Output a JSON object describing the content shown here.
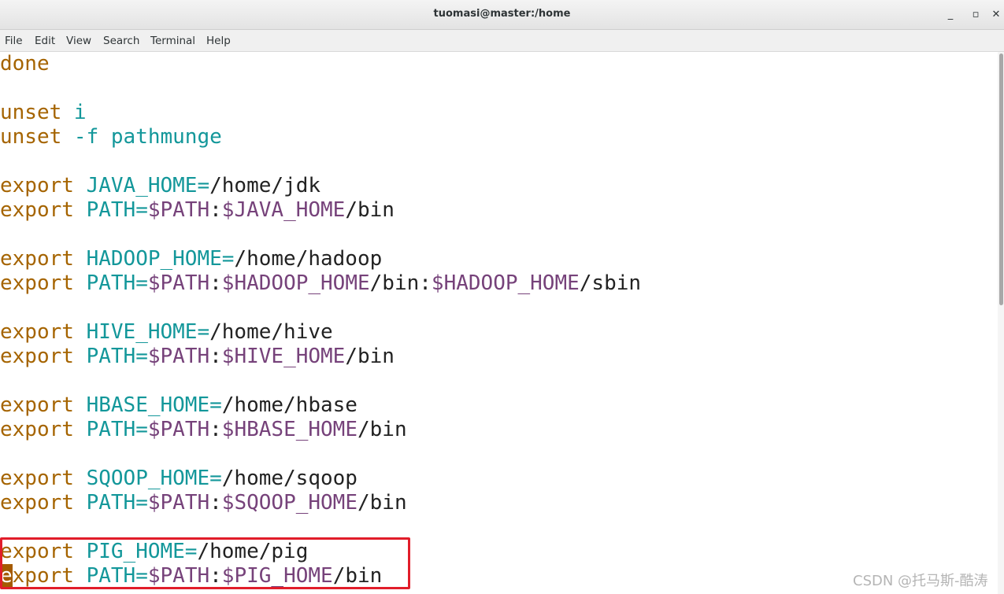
{
  "window": {
    "title": "tuomasi@master:/home",
    "min_glyph": "_",
    "max_glyph": "▫",
    "close_glyph": "✕"
  },
  "menu": {
    "items": [
      "File",
      "Edit",
      "View",
      "Search",
      "Terminal",
      "Help"
    ]
  },
  "terminal": {
    "lines": [
      [
        {
          "t": "done",
          "c": "kw"
        }
      ],
      [],
      [
        {
          "t": "unset ",
          "c": "kw"
        },
        {
          "t": "i",
          "c": "var"
        }
      ],
      [
        {
          "t": "unset ",
          "c": "kw"
        },
        {
          "t": "-f pathmunge",
          "c": "var"
        }
      ],
      [],
      [
        {
          "t": "export ",
          "c": "kw"
        },
        {
          "t": "JAVA_HOME=",
          "c": "var"
        },
        {
          "t": "/home/jdk",
          "c": "txt"
        }
      ],
      [
        {
          "t": "export ",
          "c": "kw"
        },
        {
          "t": "PATH=",
          "c": "var"
        },
        {
          "t": "$PATH",
          "c": "ref"
        },
        {
          "t": ":",
          "c": "txt"
        },
        {
          "t": "$JAVA_HOME",
          "c": "ref"
        },
        {
          "t": "/bin",
          "c": "txt"
        }
      ],
      [],
      [
        {
          "t": "export ",
          "c": "kw"
        },
        {
          "t": "HADOOP_HOME=",
          "c": "var"
        },
        {
          "t": "/home/hadoop",
          "c": "txt"
        }
      ],
      [
        {
          "t": "export ",
          "c": "kw"
        },
        {
          "t": "PATH=",
          "c": "var"
        },
        {
          "t": "$PATH",
          "c": "ref"
        },
        {
          "t": ":",
          "c": "txt"
        },
        {
          "t": "$HADOOP_HOME",
          "c": "ref"
        },
        {
          "t": "/bin:",
          "c": "txt"
        },
        {
          "t": "$HADOOP_HOME",
          "c": "ref"
        },
        {
          "t": "/sbin",
          "c": "txt"
        }
      ],
      [],
      [
        {
          "t": "export ",
          "c": "kw"
        },
        {
          "t": "HIVE_HOME=",
          "c": "var"
        },
        {
          "t": "/home/hive",
          "c": "txt"
        }
      ],
      [
        {
          "t": "export ",
          "c": "kw"
        },
        {
          "t": "PATH=",
          "c": "var"
        },
        {
          "t": "$PATH",
          "c": "ref"
        },
        {
          "t": ":",
          "c": "txt"
        },
        {
          "t": "$HIVE_HOME",
          "c": "ref"
        },
        {
          "t": "/bin",
          "c": "txt"
        }
      ],
      [],
      [
        {
          "t": "export ",
          "c": "kw"
        },
        {
          "t": "HBASE_HOME=",
          "c": "var"
        },
        {
          "t": "/home/hbase",
          "c": "txt"
        }
      ],
      [
        {
          "t": "export ",
          "c": "kw"
        },
        {
          "t": "PATH=",
          "c": "var"
        },
        {
          "t": "$PATH",
          "c": "ref"
        },
        {
          "t": ":",
          "c": "txt"
        },
        {
          "t": "$HBASE_HOME",
          "c": "ref"
        },
        {
          "t": "/bin",
          "c": "txt"
        }
      ],
      [],
      [
        {
          "t": "export ",
          "c": "kw"
        },
        {
          "t": "SQOOP_HOME=",
          "c": "var"
        },
        {
          "t": "/home/sqoop",
          "c": "txt"
        }
      ],
      [
        {
          "t": "export ",
          "c": "kw"
        },
        {
          "t": "PATH=",
          "c": "var"
        },
        {
          "t": "$PATH",
          "c": "ref"
        },
        {
          "t": ":",
          "c": "txt"
        },
        {
          "t": "$SQOOP_HOME",
          "c": "ref"
        },
        {
          "t": "/bin",
          "c": "txt"
        }
      ],
      [],
      [
        {
          "t": "export ",
          "c": "kw"
        },
        {
          "t": "PIG_HOME=",
          "c": "var"
        },
        {
          "t": "/home/pig",
          "c": "txt"
        }
      ],
      [
        {
          "t": "e",
          "c": "cursor"
        },
        {
          "t": "xport ",
          "c": "kw"
        },
        {
          "t": "PATH=",
          "c": "var"
        },
        {
          "t": "$PATH",
          "c": "ref"
        },
        {
          "t": ":",
          "c": "txt"
        },
        {
          "t": "$PIG_HOME",
          "c": "ref"
        },
        {
          "t": "/bin",
          "c": "txt"
        }
      ]
    ]
  },
  "watermark": "CSDN @托马斯-酷涛",
  "colors": {
    "keyword": "#a56400",
    "variable": "#13979a",
    "reference": "#76427a",
    "highlight_box": "#e11d2a"
  }
}
